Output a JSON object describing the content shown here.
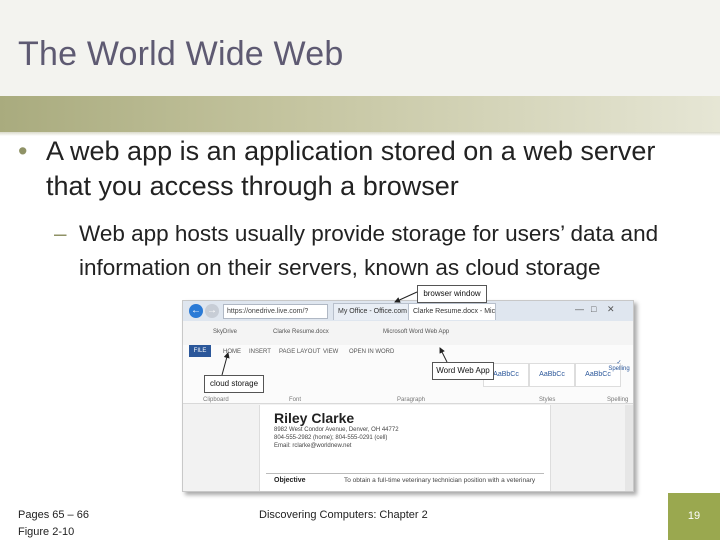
{
  "slide": {
    "title": "The World Wide Web",
    "bullet1": "A web app is an application stored on a web server that you access through a browser",
    "bullet1_marker": "•",
    "bullet2": "Web app hosts usually provide storage for users’ data and information on their servers, known as cloud storage",
    "bullet2_marker": "–",
    "footer_pages": "Pages 65 – 66",
    "footer_figure": "Figure 2-10",
    "footer_center": "Discovering Computers: Chapter 2",
    "slide_number": "19"
  },
  "figure": {
    "callouts": {
      "browser_window": "browser window",
      "word_web_app": "Word Web App",
      "cloud_storage": "cloud storage"
    },
    "browser": {
      "back_icon": "back-arrow-icon",
      "address": "https://onedrive.live.com/?",
      "tab1": "My Office - Office.com",
      "tab2": "Clarke Resume.docx - Micro...",
      "window_controls": "home-star-gear-icons"
    },
    "ribbon_tabs": [
      "SkyDrive",
      "Clarke Resume.docx",
      "Microsoft Word Web App"
    ],
    "ribbon_menu": [
      "FILE",
      "HOME",
      "INSERT",
      "PAGE LAYOUT",
      "VIEW",
      "OPEN IN WORD"
    ],
    "ribbon_groups": [
      "Clipboard",
      "Font",
      "Paragraph",
      "Styles",
      "Spelling"
    ],
    "styles": [
      "AaBbCc",
      "AaBbCc",
      "AaBbCc"
    ],
    "spelling_label": "Spelling",
    "resume": {
      "name": "Riley Clarke",
      "line1": "8982 West Condor Avenue, Denver, OH 44772",
      "line2": "804-555-2982 (home); 804-555-0291 (cell)",
      "line3": "Email: rclarke@worldnew.net",
      "objective_label": "Objective",
      "objective_text": "To obtain a full-time veterinary technician position with a veterinary"
    }
  }
}
